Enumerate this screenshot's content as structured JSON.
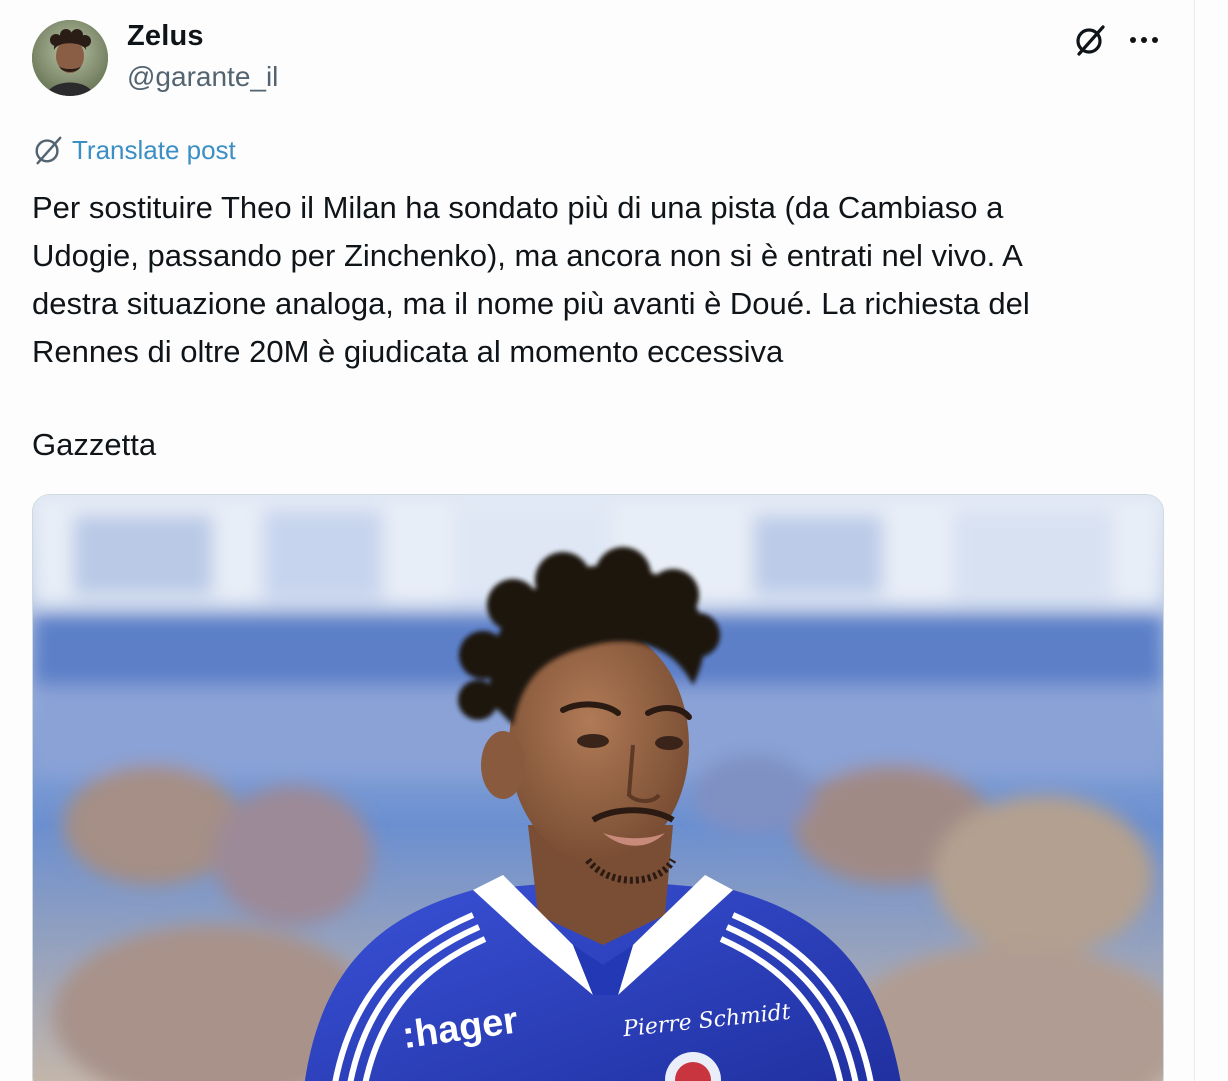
{
  "author": {
    "display_name": "Zelus",
    "handle": "@garante_il",
    "avatar_icon": "avatar"
  },
  "actions": {
    "grok_icon": "grok-icon",
    "more_icon": "more-dots-icon",
    "more_label": "···"
  },
  "translate": {
    "label": "Translate post",
    "icon": "translate-icon"
  },
  "post": {
    "lines": [
      "Per sostituire Theo il Milan ha sondato più di una pista (da Cambiaso a",
      "Udogie, passando per Zinchenko), ma ancora non si è entrati nel vivo. A",
      "destra situazione analoga, ma il nome più avanti è Doué. La richiesta del",
      "Rennes di oltre 20M è giudicata al momento eccessiva"
    ],
    "source": "Gazzetta"
  },
  "media": {
    "jersey_sponsor": ":hager",
    "jersey_script": "Pierre Schmidt",
    "colors": {
      "jersey": "#2b3fc7",
      "stadium_blue": "#4a72c8",
      "skin": "#9a6848"
    }
  },
  "colors": {
    "text": "#0f1419",
    "secondary": "#536471",
    "link": "#3b8fc4",
    "border": "#cfd9de"
  }
}
